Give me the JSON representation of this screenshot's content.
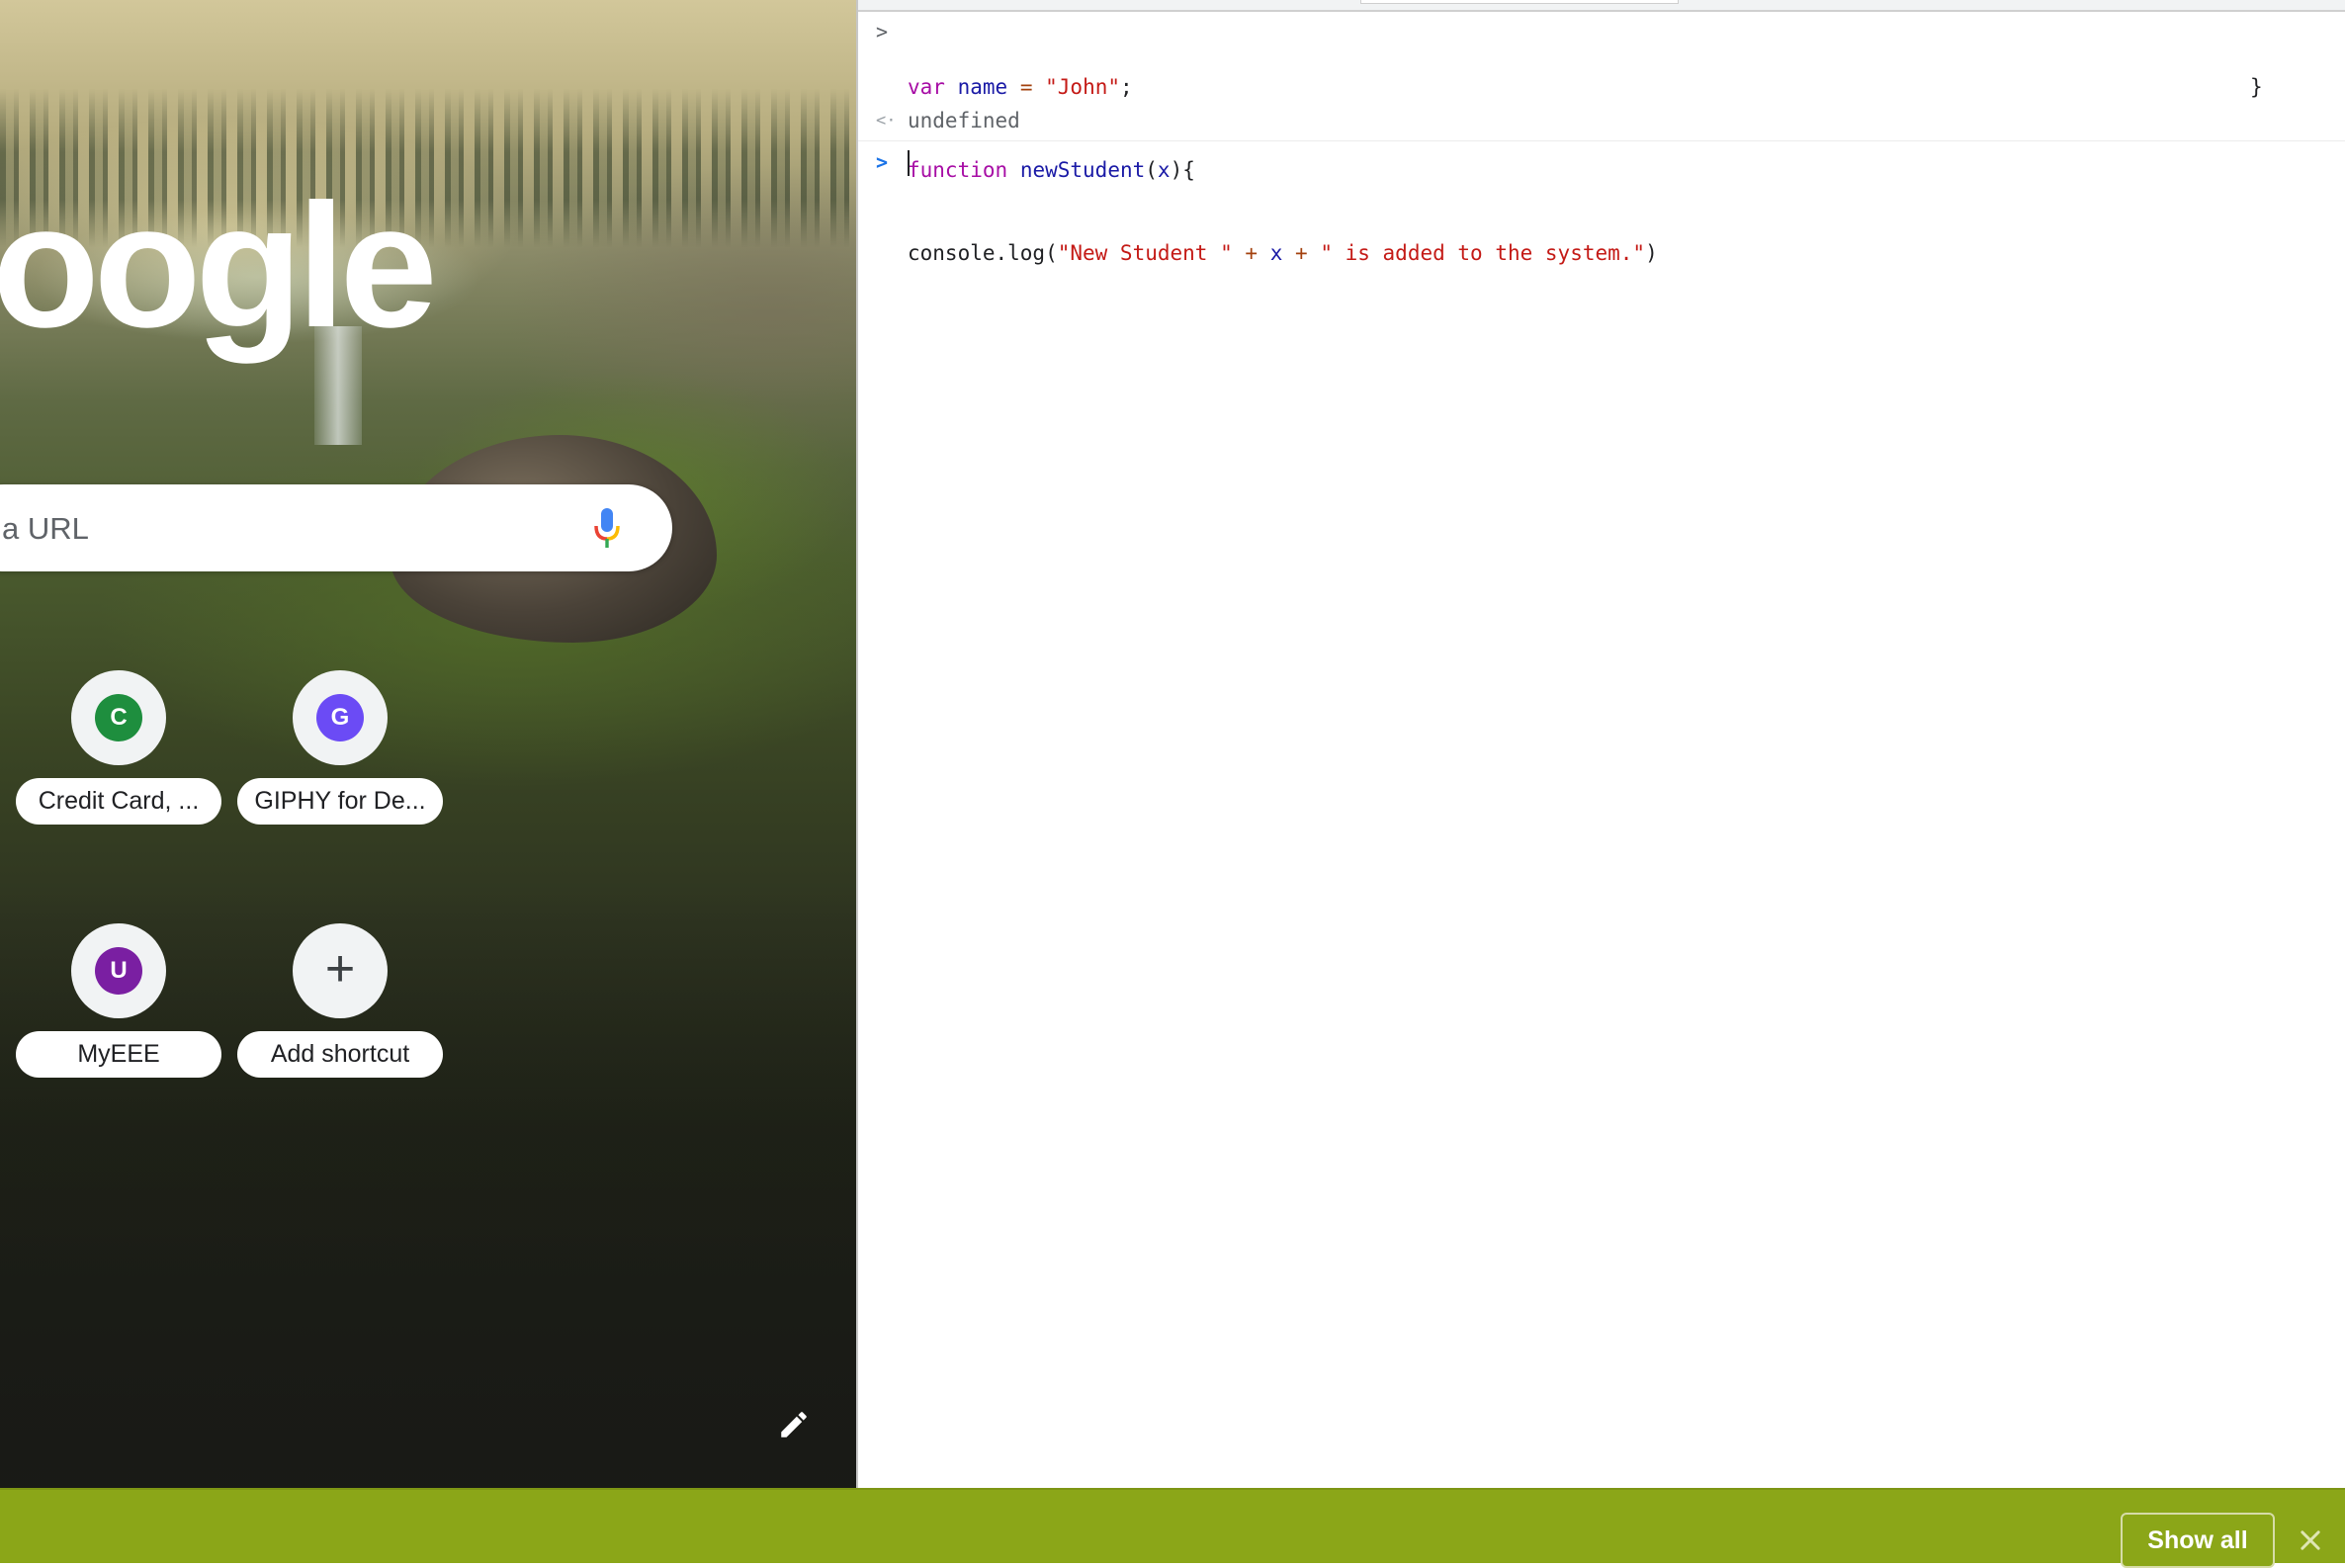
{
  "ntp": {
    "logo_text": "oogle",
    "search_placeholder": "a URL",
    "shortcuts": [
      {
        "letter": "C",
        "label": "Credit Card, ...",
        "color": "#1e8e3e"
      },
      {
        "letter": "G",
        "label": "GIPHY for De...",
        "color": "#6b4bf5"
      },
      {
        "letter": "U",
        "label": "MyEEE",
        "color": "#7a1fa2"
      },
      {
        "letter": "+",
        "label": "Add shortcut"
      }
    ]
  },
  "console": {
    "input_lines": [
      "var name = \"John\";",
      "function newStudent(x){",
      "console.log(\"New Student \" + x + \" is added to the system.\")",
      "}"
    ],
    "result": "undefined",
    "prompt_symbol": ">",
    "result_symbol": "<·"
  },
  "download_bar": {
    "show_all_label": "Show all",
    "color": "#8ba618"
  }
}
